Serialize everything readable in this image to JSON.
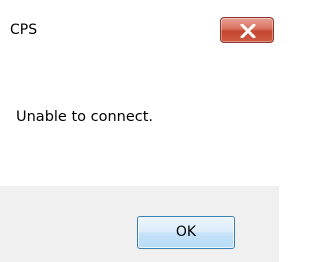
{
  "window": {
    "title": "CPS",
    "close_icon": "close-icon"
  },
  "message": {
    "text": "Unable to connect."
  },
  "buttons": {
    "ok_label": "OK"
  },
  "colors": {
    "close_button": "#c5452f",
    "footer_background": "#f0f0f0",
    "ok_button_border": "#3c7fb1"
  }
}
